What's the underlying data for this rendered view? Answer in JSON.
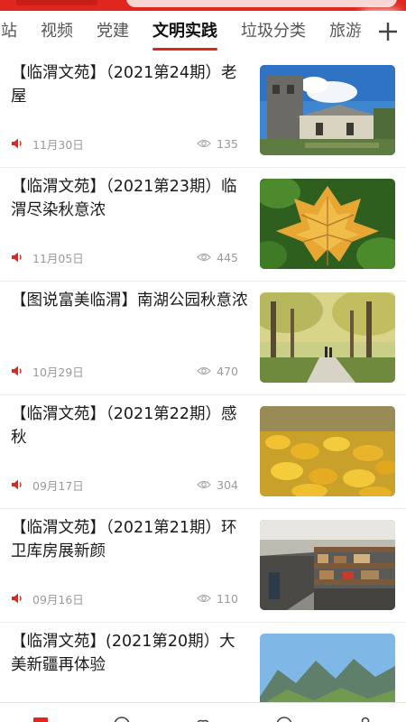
{
  "tabs": [
    {
      "label": "站",
      "active": false
    },
    {
      "label": "视频",
      "active": false
    },
    {
      "label": "党建",
      "active": false
    },
    {
      "label": "文明实践",
      "active": true
    },
    {
      "label": "垃圾分类",
      "active": false
    },
    {
      "label": "旅游",
      "active": false
    }
  ],
  "articles": [
    {
      "title": "【临渭文苑】（2021第24期）老 屋",
      "date": "11月30日",
      "views": "135"
    },
    {
      "title": "【临渭文苑】（2021第23期）临渭尽染秋意浓",
      "date": "11月05日",
      "views": "445"
    },
    {
      "title": "【图说富美临渭】南湖公园秋意浓",
      "date": "10月29日",
      "views": "470"
    },
    {
      "title": "【临渭文苑】（2021第22期）感秋",
      "date": "09月17日",
      "views": "304"
    },
    {
      "title": "【临渭文苑】（2021第21期）环卫库房展新颜",
      "date": "09月16日",
      "views": "110"
    },
    {
      "title": "【临渭文苑】(2021第20期）大美新疆再体验",
      "date": "",
      "views": ""
    }
  ],
  "colors": {
    "accent": "#d9271e",
    "muted": "#999999"
  }
}
